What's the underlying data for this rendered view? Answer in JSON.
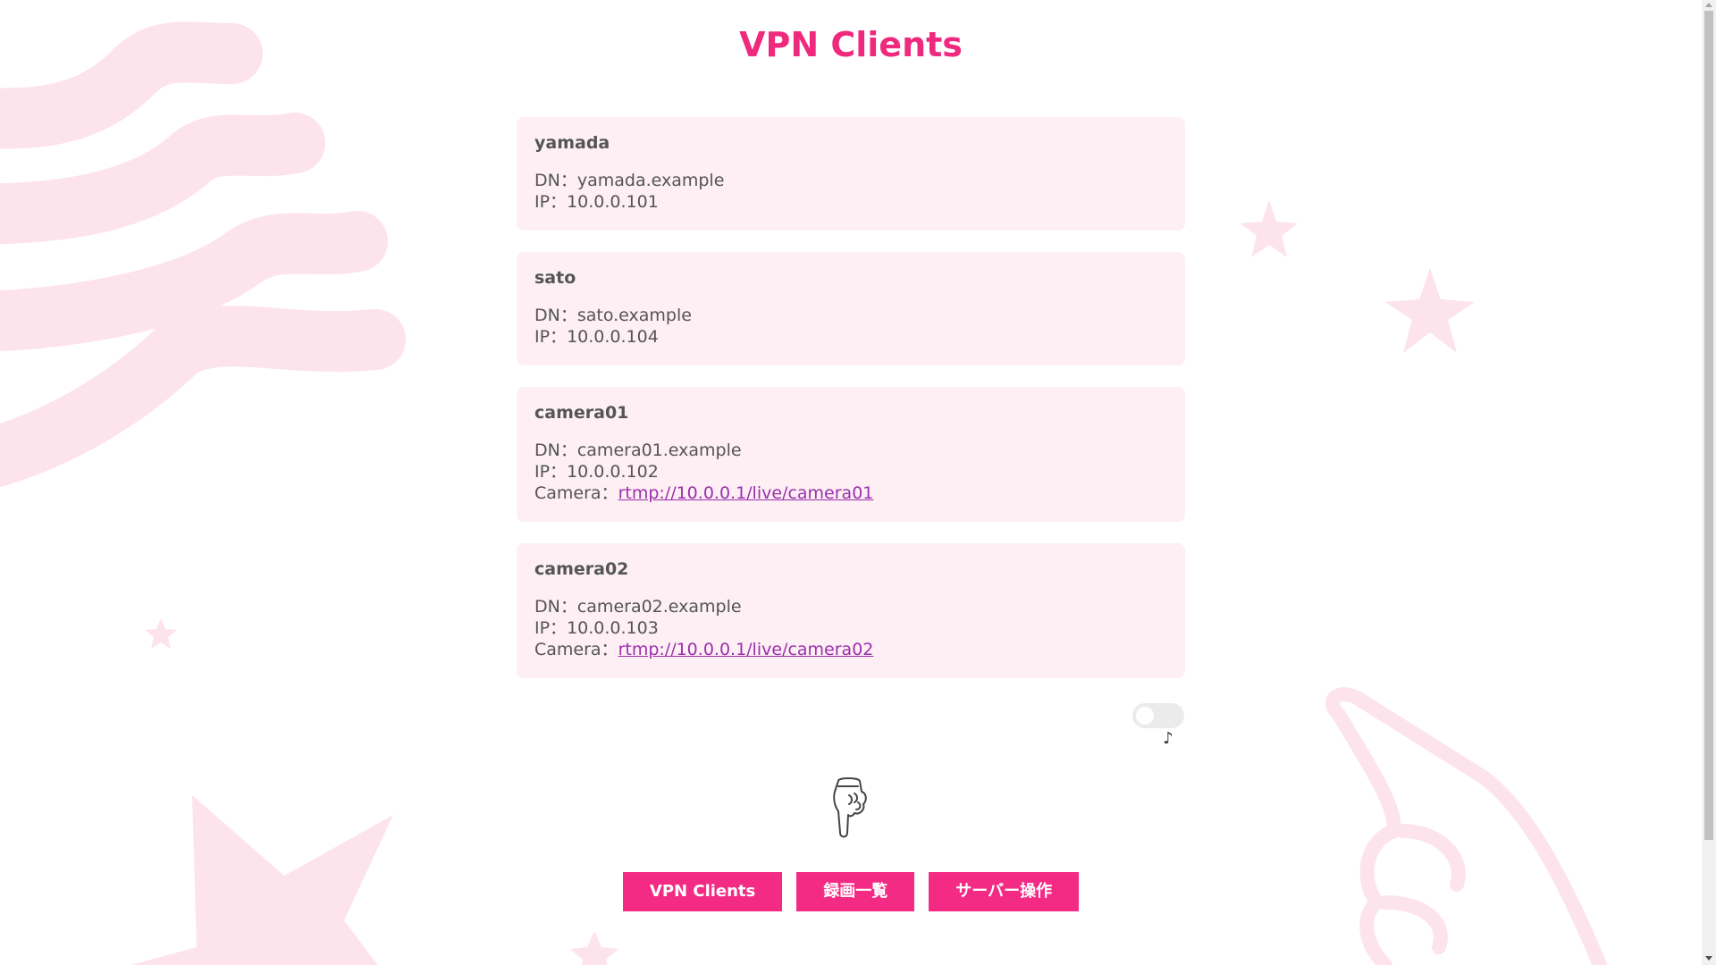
{
  "page": {
    "title": "VPN Clients"
  },
  "clients": [
    {
      "name": "yamada",
      "dn_label": "DN：",
      "dn": "yamada.example",
      "ip_label": "IP：",
      "ip": "10.0.0.101"
    },
    {
      "name": "sato",
      "dn_label": "DN：",
      "dn": "sato.example",
      "ip_label": "IP：",
      "ip": "10.0.0.104"
    },
    {
      "name": "camera01",
      "dn_label": "DN：",
      "dn": "camera01.example",
      "ip_label": "IP：",
      "ip": "10.0.0.102",
      "camera_label": "Camera：",
      "camera": "rtmp://10.0.0.1/live/camera01"
    },
    {
      "name": "camera02",
      "dn_label": "DN：",
      "dn": "camera02.example",
      "ip_label": "IP：",
      "ip": "10.0.0.103",
      "camera_label": "Camera：",
      "camera": "rtmp://10.0.0.1/live/camera02"
    }
  ],
  "music_toggle": {
    "state": "off",
    "note_symbol": "♪"
  },
  "pointer_icon": "pointing-down-hand-icon",
  "nav": {
    "vpn_clients": "VPN Clients",
    "recordings": "録画一覧",
    "server_ops": "サーバー操作"
  },
  "colors": {
    "accent": "#f42b84",
    "title": "#ef2a7e",
    "card_bg": "#fdeff4",
    "decor": "#fde3ec",
    "link": "#9b2fae"
  }
}
